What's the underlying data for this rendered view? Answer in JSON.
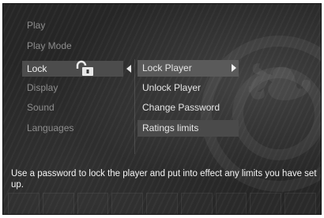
{
  "main_menu": {
    "items": [
      {
        "label": "Play"
      },
      {
        "label": "Play Mode"
      },
      {
        "label": "Lock"
      },
      {
        "label": "Display"
      },
      {
        "label": "Sound"
      },
      {
        "label": "Languages"
      }
    ],
    "selected": "Lock"
  },
  "submenu": {
    "items": [
      {
        "label": "Lock Player"
      },
      {
        "label": "Unlock Player"
      },
      {
        "label": "Change Password"
      },
      {
        "label": "Ratings limits"
      }
    ],
    "selected": "Lock Player"
  },
  "help_text": "Use a password to lock the player and put into effect any limits you have set up.",
  "icons": {
    "lock": "lock-icon",
    "left_arrow": "arrow-left-icon",
    "right_arrow": "arrow-right-icon"
  },
  "colors": {
    "background": "#262626",
    "selected_bg": "#4c4c4c",
    "text_inactive": "#8d8d8d",
    "text_active": "#f2f2f2"
  }
}
